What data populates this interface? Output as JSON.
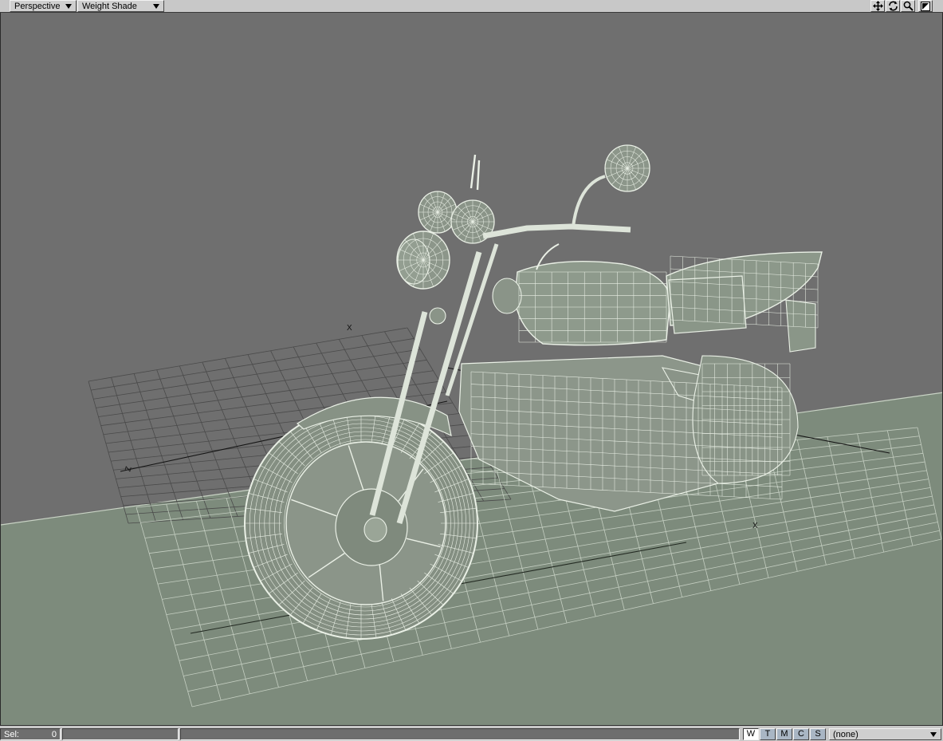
{
  "header": {
    "view_mode": "Perspective",
    "shading_mode": "Weight Shade",
    "icons": [
      "move-icon",
      "rotate-icon",
      "zoom-icon",
      "maximize-icon"
    ]
  },
  "viewport": {
    "background_color": "#6f6f6f",
    "floor_color": "#7d8b7c",
    "wire_color": "#e9efe6",
    "axis_labels": [
      "X",
      "Z",
      "X"
    ]
  },
  "status": {
    "sel_label": "Sel:",
    "sel_count": "0",
    "modes": [
      "W",
      "T",
      "M",
      "C",
      "S"
    ],
    "active_mode": "W",
    "map_value": "(none)"
  }
}
